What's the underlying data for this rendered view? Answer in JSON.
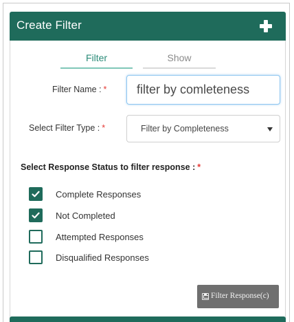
{
  "header": {
    "title": "Create Filter",
    "add_icon": "plus-icon"
  },
  "tabs": [
    {
      "label": "Filter",
      "active": true
    },
    {
      "label": "Show",
      "active": false
    }
  ],
  "form": {
    "filter_name_label": "Filter Name :",
    "filter_name_value": "filter by comleteness",
    "filter_type_label": "Select Filter Type :",
    "filter_type_value": "Filter by Completeness",
    "required_marker": "*"
  },
  "status_section": {
    "label": "Select Response Status to filter response :",
    "options": [
      {
        "label": "Complete Responses",
        "checked": true
      },
      {
        "label": "Not Completed",
        "checked": true
      },
      {
        "label": "Attempted Responses",
        "checked": false
      },
      {
        "label": "Disqualified Responses",
        "checked": false
      }
    ]
  },
  "actions": {
    "apply_label": "Filter Response(c)",
    "apply_icon": "save-icon"
  },
  "colors": {
    "accent": "#1f6b5b",
    "tab_active": "#2a8b78",
    "required": "#e53935",
    "button": "#6f6f6f"
  }
}
